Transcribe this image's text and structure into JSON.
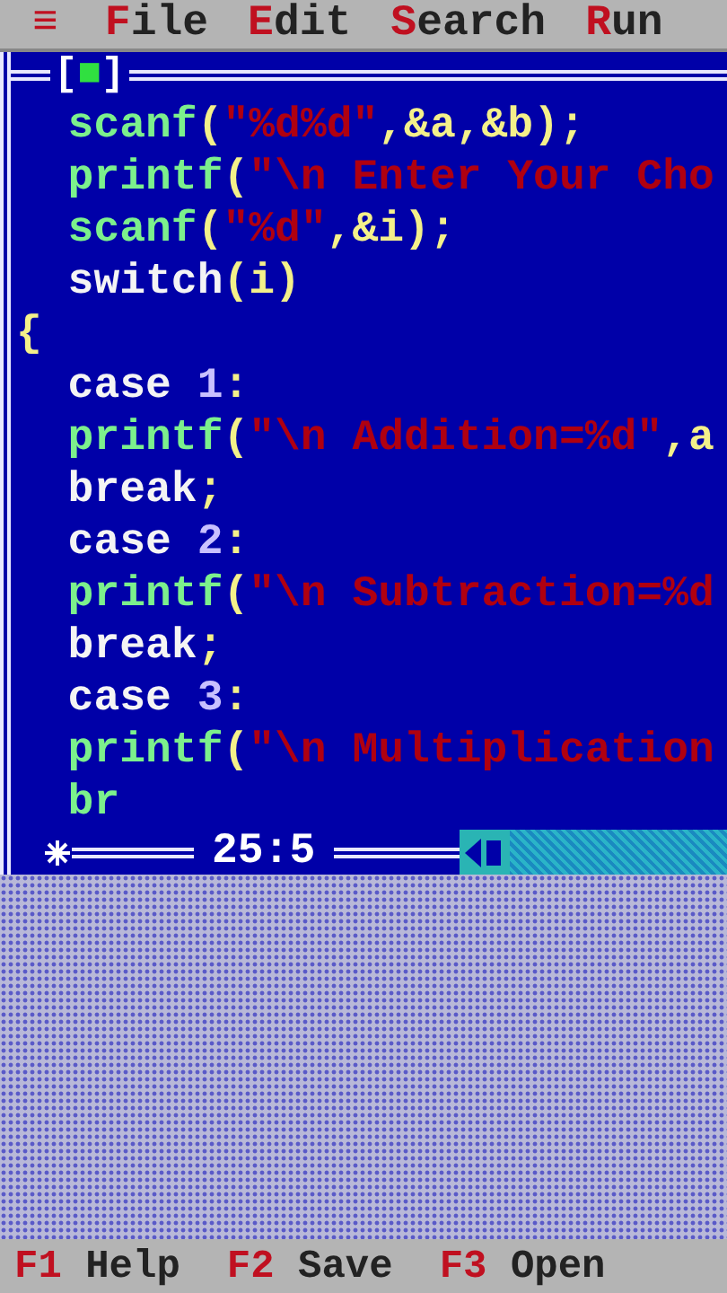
{
  "menu": {
    "system": "≡",
    "items": [
      {
        "hotkey": "F",
        "rest": "ile"
      },
      {
        "hotkey": "E",
        "rest": "dit"
      },
      {
        "hotkey": "S",
        "rest": "earch"
      },
      {
        "hotkey": "R",
        "rest": "un"
      }
    ]
  },
  "editor": {
    "close_button": "[■]",
    "position": "25:5",
    "lines": [
      [
        {
          "kind": "func",
          "text": "  scanf"
        },
        {
          "kind": "punct",
          "text": "("
        },
        {
          "kind": "string",
          "text": "\"%d%d\""
        },
        {
          "kind": "punct",
          "text": ",&a,&b);"
        }
      ],
      [
        {
          "kind": "func",
          "text": "  printf"
        },
        {
          "kind": "punct",
          "text": "("
        },
        {
          "kind": "string",
          "text": "\"\\n Enter Your Cho"
        }
      ],
      [
        {
          "kind": "func",
          "text": "  scanf"
        },
        {
          "kind": "punct",
          "text": "("
        },
        {
          "kind": "string",
          "text": "\"%d\""
        },
        {
          "kind": "punct",
          "text": ",&i);"
        }
      ],
      [
        {
          "kind": "keyword",
          "text": "  switch"
        },
        {
          "kind": "punct",
          "text": "(i)"
        }
      ],
      [
        {
          "kind": "punct",
          "text": "{"
        }
      ],
      [
        {
          "kind": "keyword",
          "text": "  case "
        },
        {
          "kind": "number",
          "text": "1"
        },
        {
          "kind": "punct",
          "text": ":"
        }
      ],
      [
        {
          "kind": "func",
          "text": "  printf"
        },
        {
          "kind": "punct",
          "text": "("
        },
        {
          "kind": "string",
          "text": "\"\\n Addition=%d\""
        },
        {
          "kind": "punct",
          "text": ",a"
        }
      ],
      [
        {
          "kind": "keyword",
          "text": "  break"
        },
        {
          "kind": "punct",
          "text": ";"
        }
      ],
      [
        {
          "kind": "keyword",
          "text": "  case "
        },
        {
          "kind": "number",
          "text": "2"
        },
        {
          "kind": "punct",
          "text": ":"
        }
      ],
      [
        {
          "kind": "func",
          "text": "  printf"
        },
        {
          "kind": "punct",
          "text": "("
        },
        {
          "kind": "string",
          "text": "\"\\n Subtraction=%d"
        }
      ],
      [
        {
          "kind": "keyword",
          "text": "  break"
        },
        {
          "kind": "punct",
          "text": ";"
        }
      ],
      [
        {
          "kind": "keyword",
          "text": "  case "
        },
        {
          "kind": "number",
          "text": "3"
        },
        {
          "kind": "punct",
          "text": ":"
        }
      ],
      [
        {
          "kind": "func",
          "text": "  printf"
        },
        {
          "kind": "punct",
          "text": "("
        },
        {
          "kind": "string",
          "text": "\"\\n Multiplication"
        }
      ],
      [
        {
          "kind": "func",
          "text": "  br"
        }
      ]
    ]
  },
  "status_bar": [
    {
      "key": "F1",
      "label": "Help"
    },
    {
      "key": "F2",
      "label": "Save"
    },
    {
      "key": "F3",
      "label": "Open"
    }
  ]
}
